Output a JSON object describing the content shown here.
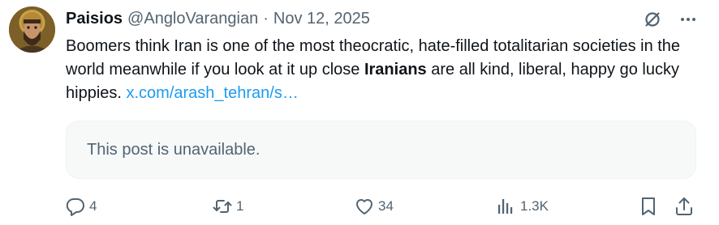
{
  "post": {
    "display_name": "Paisios",
    "handle": "@AngloVarangian",
    "separator": "·",
    "date": "Nov 12, 2025",
    "text_part1": "Boomers think Iran is one of the most theocratic, hate-filled totalitarian societies in the world meanwhile if you look at it up close ",
    "text_bold": "Iranians",
    "text_part2": " are all kind, liberal, happy go lucky hippies. ",
    "link_text": "x.com/arash_tehran/s…",
    "quoted_unavailable": "This post is unavailable."
  },
  "actions": {
    "replies": "4",
    "reposts": "1",
    "likes": "34",
    "views": "1.3K"
  },
  "icons": {
    "grok": "grok-icon",
    "more": "more-icon",
    "reply": "reply-icon",
    "repost": "repost-icon",
    "like": "heart-icon",
    "views": "views-icon",
    "bookmark": "bookmark-icon",
    "share": "share-icon"
  },
  "colors": {
    "link": "#1d9bf0",
    "muted": "#536471",
    "text": "#0f1419",
    "card_bg": "#f7f9f9"
  }
}
